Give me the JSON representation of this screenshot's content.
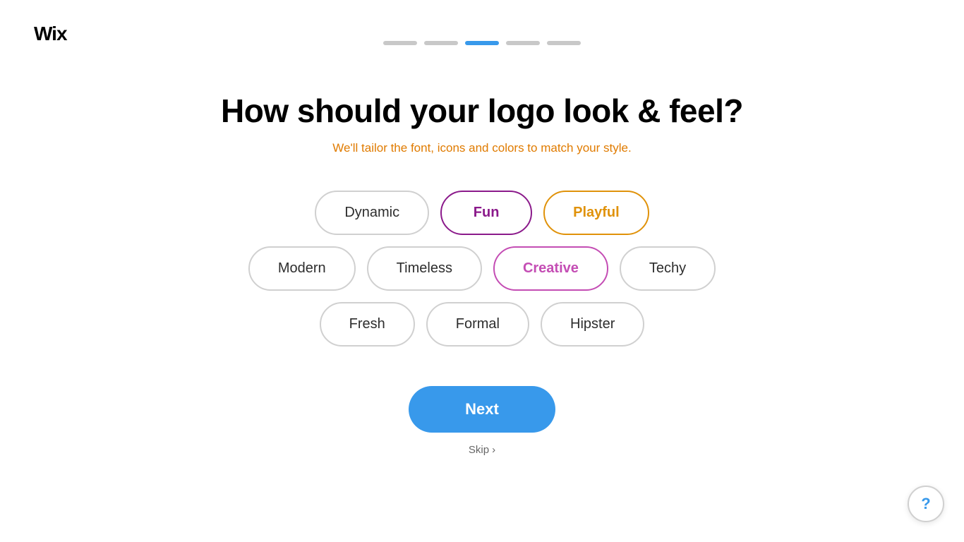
{
  "logo": {
    "text": "Wix"
  },
  "progress": {
    "steps": [
      {
        "id": 1,
        "active": false
      },
      {
        "id": 2,
        "active": false
      },
      {
        "id": 3,
        "active": true
      },
      {
        "id": 4,
        "active": false
      },
      {
        "id": 5,
        "active": false
      }
    ]
  },
  "page": {
    "title": "How should your logo look & feel?",
    "subtitle": "We'll tailor the font, icons and colors to match your style."
  },
  "options": {
    "row1": [
      {
        "id": "dynamic",
        "label": "Dynamic",
        "selected": false,
        "style": "default"
      },
      {
        "id": "fun",
        "label": "Fun",
        "selected": true,
        "style": "selected-purple"
      },
      {
        "id": "playful",
        "label": "Playful",
        "selected": true,
        "style": "selected-orange"
      }
    ],
    "row2": [
      {
        "id": "modern",
        "label": "Modern",
        "selected": false,
        "style": "default"
      },
      {
        "id": "timeless",
        "label": "Timeless",
        "selected": false,
        "style": "default"
      },
      {
        "id": "creative",
        "label": "Creative",
        "selected": true,
        "style": "selected-pink"
      },
      {
        "id": "techy",
        "label": "Techy",
        "selected": false,
        "style": "default"
      }
    ],
    "row3": [
      {
        "id": "fresh",
        "label": "Fresh",
        "selected": false,
        "style": "default"
      },
      {
        "id": "formal",
        "label": "Formal",
        "selected": false,
        "style": "default"
      },
      {
        "id": "hipster",
        "label": "Hipster",
        "selected": false,
        "style": "default"
      }
    ]
  },
  "buttons": {
    "next": "Next",
    "skip": "Skip",
    "skip_arrow": "›",
    "help": "?"
  }
}
